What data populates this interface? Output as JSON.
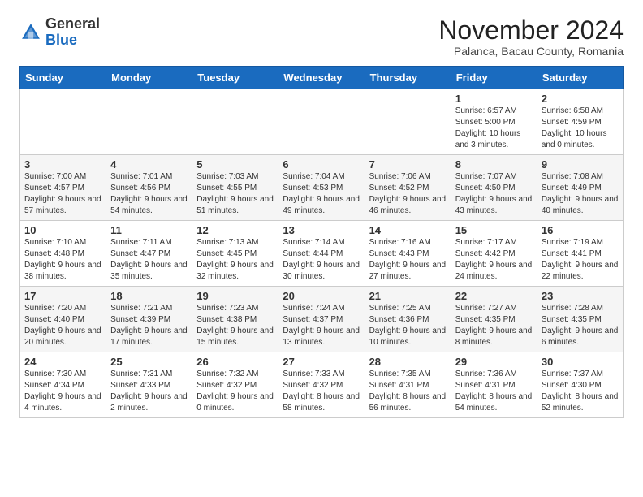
{
  "header": {
    "logo_general": "General",
    "logo_blue": "Blue",
    "month_title": "November 2024",
    "subtitle": "Palanca, Bacau County, Romania"
  },
  "days_of_week": [
    "Sunday",
    "Monday",
    "Tuesday",
    "Wednesday",
    "Thursday",
    "Friday",
    "Saturday"
  ],
  "weeks": [
    [
      {
        "day": "",
        "info": ""
      },
      {
        "day": "",
        "info": ""
      },
      {
        "day": "",
        "info": ""
      },
      {
        "day": "",
        "info": ""
      },
      {
        "day": "",
        "info": ""
      },
      {
        "day": "1",
        "info": "Sunrise: 6:57 AM\nSunset: 5:00 PM\nDaylight: 10 hours and 3 minutes."
      },
      {
        "day": "2",
        "info": "Sunrise: 6:58 AM\nSunset: 4:59 PM\nDaylight: 10 hours and 0 minutes."
      }
    ],
    [
      {
        "day": "3",
        "info": "Sunrise: 7:00 AM\nSunset: 4:57 PM\nDaylight: 9 hours and 57 minutes."
      },
      {
        "day": "4",
        "info": "Sunrise: 7:01 AM\nSunset: 4:56 PM\nDaylight: 9 hours and 54 minutes."
      },
      {
        "day": "5",
        "info": "Sunrise: 7:03 AM\nSunset: 4:55 PM\nDaylight: 9 hours and 51 minutes."
      },
      {
        "day": "6",
        "info": "Sunrise: 7:04 AM\nSunset: 4:53 PM\nDaylight: 9 hours and 49 minutes."
      },
      {
        "day": "7",
        "info": "Sunrise: 7:06 AM\nSunset: 4:52 PM\nDaylight: 9 hours and 46 minutes."
      },
      {
        "day": "8",
        "info": "Sunrise: 7:07 AM\nSunset: 4:50 PM\nDaylight: 9 hours and 43 minutes."
      },
      {
        "day": "9",
        "info": "Sunrise: 7:08 AM\nSunset: 4:49 PM\nDaylight: 9 hours and 40 minutes."
      }
    ],
    [
      {
        "day": "10",
        "info": "Sunrise: 7:10 AM\nSunset: 4:48 PM\nDaylight: 9 hours and 38 minutes."
      },
      {
        "day": "11",
        "info": "Sunrise: 7:11 AM\nSunset: 4:47 PM\nDaylight: 9 hours and 35 minutes."
      },
      {
        "day": "12",
        "info": "Sunrise: 7:13 AM\nSunset: 4:45 PM\nDaylight: 9 hours and 32 minutes."
      },
      {
        "day": "13",
        "info": "Sunrise: 7:14 AM\nSunset: 4:44 PM\nDaylight: 9 hours and 30 minutes."
      },
      {
        "day": "14",
        "info": "Sunrise: 7:16 AM\nSunset: 4:43 PM\nDaylight: 9 hours and 27 minutes."
      },
      {
        "day": "15",
        "info": "Sunrise: 7:17 AM\nSunset: 4:42 PM\nDaylight: 9 hours and 24 minutes."
      },
      {
        "day": "16",
        "info": "Sunrise: 7:19 AM\nSunset: 4:41 PM\nDaylight: 9 hours and 22 minutes."
      }
    ],
    [
      {
        "day": "17",
        "info": "Sunrise: 7:20 AM\nSunset: 4:40 PM\nDaylight: 9 hours and 20 minutes."
      },
      {
        "day": "18",
        "info": "Sunrise: 7:21 AM\nSunset: 4:39 PM\nDaylight: 9 hours and 17 minutes."
      },
      {
        "day": "19",
        "info": "Sunrise: 7:23 AM\nSunset: 4:38 PM\nDaylight: 9 hours and 15 minutes."
      },
      {
        "day": "20",
        "info": "Sunrise: 7:24 AM\nSunset: 4:37 PM\nDaylight: 9 hours and 13 minutes."
      },
      {
        "day": "21",
        "info": "Sunrise: 7:25 AM\nSunset: 4:36 PM\nDaylight: 9 hours and 10 minutes."
      },
      {
        "day": "22",
        "info": "Sunrise: 7:27 AM\nSunset: 4:35 PM\nDaylight: 9 hours and 8 minutes."
      },
      {
        "day": "23",
        "info": "Sunrise: 7:28 AM\nSunset: 4:35 PM\nDaylight: 9 hours and 6 minutes."
      }
    ],
    [
      {
        "day": "24",
        "info": "Sunrise: 7:30 AM\nSunset: 4:34 PM\nDaylight: 9 hours and 4 minutes."
      },
      {
        "day": "25",
        "info": "Sunrise: 7:31 AM\nSunset: 4:33 PM\nDaylight: 9 hours and 2 minutes."
      },
      {
        "day": "26",
        "info": "Sunrise: 7:32 AM\nSunset: 4:32 PM\nDaylight: 9 hours and 0 minutes."
      },
      {
        "day": "27",
        "info": "Sunrise: 7:33 AM\nSunset: 4:32 PM\nDaylight: 8 hours and 58 minutes."
      },
      {
        "day": "28",
        "info": "Sunrise: 7:35 AM\nSunset: 4:31 PM\nDaylight: 8 hours and 56 minutes."
      },
      {
        "day": "29",
        "info": "Sunrise: 7:36 AM\nSunset: 4:31 PM\nDaylight: 8 hours and 54 minutes."
      },
      {
        "day": "30",
        "info": "Sunrise: 7:37 AM\nSunset: 4:30 PM\nDaylight: 8 hours and 52 minutes."
      }
    ]
  ]
}
